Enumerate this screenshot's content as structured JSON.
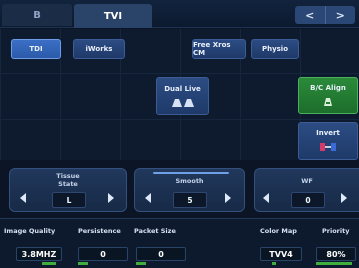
{
  "tabs": [
    {
      "label": "B"
    },
    {
      "label": "TVI"
    }
  ],
  "nav": {
    "prev": "<",
    "next": ">"
  },
  "buttons": {
    "tdi": "TDI",
    "iworks": "iWorks",
    "free_xros": "Free Xros CM",
    "physio": "Physio",
    "dual_live": "Dual Live",
    "bc_align": "B/C Align",
    "invert": "Invert"
  },
  "spinners": [
    {
      "title": "Tissue State",
      "value": "L"
    },
    {
      "title": "Smooth",
      "value": "5"
    },
    {
      "title": "WF",
      "value": "0"
    }
  ],
  "params": [
    {
      "label": "Image Quality",
      "value": "3.8MHZ"
    },
    {
      "label": "Persistence",
      "value": "0"
    },
    {
      "label": "Packet Size",
      "value": "0"
    },
    {
      "label": "Color Map",
      "value": "TVV4"
    },
    {
      "label": "Priority",
      "value": "80%"
    }
  ],
  "colors": {
    "accent": "#2b5aa9",
    "active_green": "#2a8a3a",
    "indicator": "#3fae3d"
  }
}
